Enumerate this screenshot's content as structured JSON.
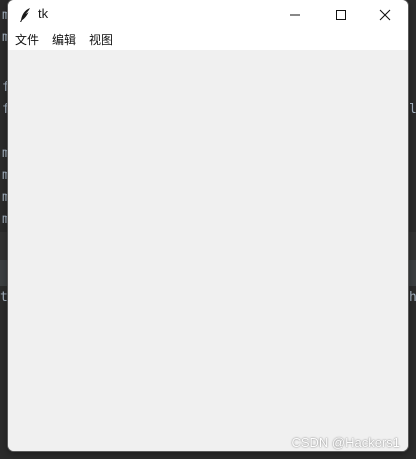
{
  "window": {
    "title": "tk",
    "controls": {
      "minimize": "minimize-icon",
      "maximize": "maximize-icon",
      "close": "close-icon"
    }
  },
  "menubar": {
    "items": [
      {
        "label": "文件"
      },
      {
        "label": "编辑"
      },
      {
        "label": "视图"
      }
    ]
  },
  "background": {
    "edge_chars_left": [
      "m",
      "m",
      "f",
      "f",
      "m",
      "m",
      "m",
      "m",
      "t"
    ],
    "edge_chars_right": [
      "l",
      "h"
    ]
  },
  "watermark": {
    "text": "CSDN @Hackers1"
  },
  "colors": {
    "titlebar": "#ffffff",
    "client_area": "#f0f0f0",
    "editor_bg": "#2b2b2b"
  }
}
